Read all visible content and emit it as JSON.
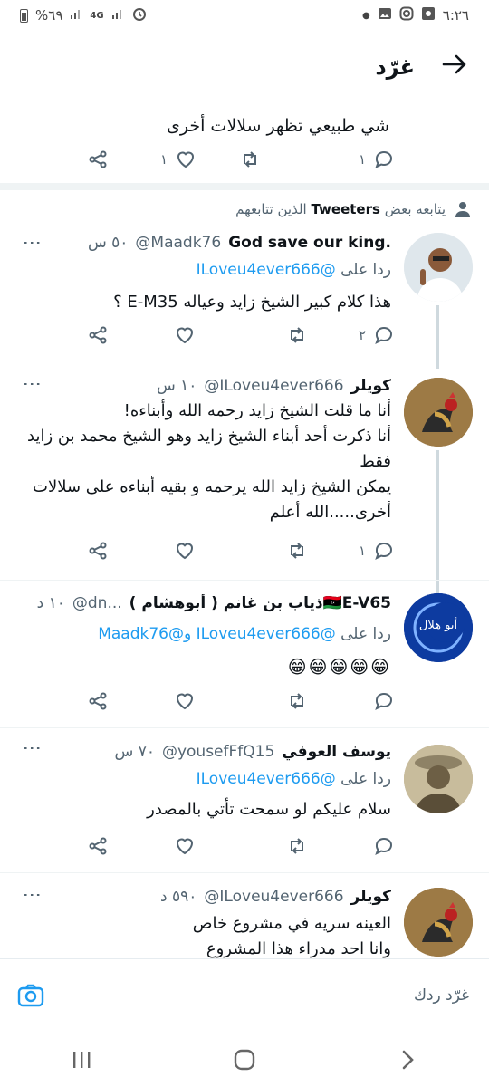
{
  "status_bar": {
    "time": "٦:٢٦",
    "battery": "%٦٩",
    "network": "4G"
  },
  "header": {
    "title": "غرّد"
  },
  "prev_tweet": {
    "text_partial": "شي طبيعي تظهر سلالات أخرى",
    "reply_count": "١",
    "like_count": "١"
  },
  "social_context": {
    "prefix": "يتابعه بعض",
    "bold": "Tweeters",
    "suffix": "الذين تتابعهم"
  },
  "tweets": [
    {
      "name": "God save our king.",
      "handle": "@Maadk76",
      "time": "٥٠ س",
      "reply_label": "ردا على",
      "reply_handles": "@ILoveu4ever666",
      "text": "هذا كلام كبير الشيخ زايد وعياله E-M35 ؟",
      "reply_count": "٢",
      "like_count": "",
      "retweet_count": ""
    },
    {
      "name": "كويلر",
      "handle": "@ILoveu4ever666",
      "time": "١٠ س",
      "text_lines": [
        "أنا ما قلت الشيخ زايد رحمه الله وأبناءه!",
        "أنا ذكرت أحد أبناء الشيخ زايد وهو الشيخ محمد بن زايد فقط",
        "يمكن الشيخ زايد الله يرحمه و بقيه أبناءه على سلالات أخرى.....الله أعلم"
      ],
      "reply_count": "١"
    },
    {
      "name": "ذياب بن غانم ( أبوهشام )🇱🇾E-V65",
      "handle": "@dn...",
      "time": "١٠ د",
      "reply_label": "ردا على",
      "reply_handles": "@ILoveu4ever666 و@Maadk76",
      "text": "😁😁😁😁😁",
      "avatar_text": "أبو هلال"
    },
    {
      "name": "يوسف العوفي",
      "handle": "@yousefFfQ15",
      "time": "٧٠ س",
      "reply_label": "ردا على",
      "reply_handles": "@ILoveu4ever666",
      "text": "سلام عليكم لو سمحت تأتي بالمصدر"
    },
    {
      "name": "كويلر",
      "handle": "@ILoveu4ever666",
      "time": "٥٩٠ د",
      "text_lines": [
        "العينه سريه في مشروع خاص",
        "وانا احد مدراء هذا المشروع"
      ]
    }
  ],
  "compose": {
    "placeholder": "غرّد ردك"
  },
  "colors": {
    "accent": "#1d9bf0",
    "muted": "#536471",
    "text": "#0f1419"
  }
}
